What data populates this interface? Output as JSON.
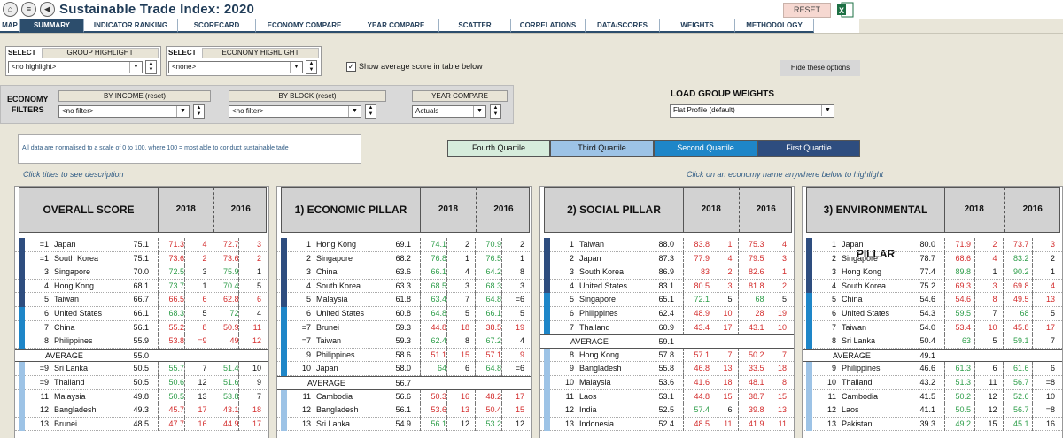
{
  "app": {
    "title": "Sustainable Trade Index: 2020",
    "reset_label": "RESET"
  },
  "tabs": [
    "MAP",
    "SUMMARY",
    "INDICATOR RANKING",
    "SCORECARD",
    "ECONOMY COMPARE",
    "YEAR COMPARE",
    "SCATTER",
    "CORRELATIONS",
    "DATA/SCORES",
    "WEIGHTS",
    "METHODOLOGY"
  ],
  "active_tab": "SUMMARY",
  "select_group": {
    "select_label": "SELECT",
    "title": "GROUP HIGHLIGHT",
    "value": "<no highlight>"
  },
  "select_economy": {
    "select_label": "SELECT",
    "title": "ECONOMY HIGHLIGHT",
    "value": "<none>"
  },
  "show_avg": {
    "label": "Show average score in table below",
    "checked": true
  },
  "hide_options_label": "Hide these options",
  "filters": {
    "label_line1": "ECONOMY",
    "label_line2": "FILTERS",
    "by_income": {
      "title": "BY INCOME (reset)",
      "value": "no filter>"
    },
    "by_block": {
      "title": "BY BLOCK (reset)",
      "value": "no filter>"
    },
    "year_compare": {
      "title": "YEAR COMPARE",
      "value": "Actuals"
    }
  },
  "weights": {
    "title": "LOAD GROUP WEIGHTS",
    "value": "Flat Profile (default)"
  },
  "note": "All data are normalised to a scale of 0 to 100, where 100 = most able to conduct sustainable tade",
  "quartiles": [
    {
      "label": "Fourth Quartile",
      "color": "#d6ecdc"
    },
    {
      "label": "Third Quartile",
      "color": "#9dc3e6"
    },
    {
      "label": "Second Quartile",
      "color": "#1e86c8"
    },
    {
      "label": "First Quartile",
      "color": "#2e4d7f"
    }
  ],
  "hints": {
    "left": "Click titles to see description",
    "right": "Click on an economy name anywhere below to highlight"
  },
  "panels": [
    {
      "title": "OVERALL SCORE",
      "y1": "2018",
      "y2": "2016",
      "rows": [
        {
          "q": 1,
          "rank": "=1",
          "name": "Japan",
          "score": "75.1",
          "v1": "71.3",
          "c1": "r",
          "r1": "4",
          "v2": "72.7",
          "c2": "r",
          "r2": "3"
        },
        {
          "q": 1,
          "rank": "=1",
          "name": "South Korea",
          "score": "75.1",
          "v1": "73.6",
          "c1": "r",
          "r1": "2",
          "v2": "73.6",
          "c2": "r",
          "r2": "2"
        },
        {
          "q": 1,
          "rank": "3",
          "name": "Singapore",
          "score": "70.0",
          "v1": "72.5",
          "c1": "g",
          "r1": "3",
          "v2": "75.9",
          "c2": "g",
          "r2": "1"
        },
        {
          "q": 1,
          "rank": "4",
          "name": "Hong Kong",
          "score": "68.1",
          "v1": "73.7",
          "c1": "g",
          "r1": "1",
          "v2": "70.4",
          "c2": "g",
          "r2": "5"
        },
        {
          "q": 1,
          "rank": "5",
          "name": "Taiwan",
          "score": "66.7",
          "v1": "66.5",
          "c1": "r",
          "r1": "6",
          "v2": "62.8",
          "c2": "r",
          "r2": "6"
        },
        {
          "q": 2,
          "rank": "6",
          "name": "United States",
          "score": "66.1",
          "v1": "68.3",
          "c1": "g",
          "r1": "5",
          "v2": "72",
          "c2": "g",
          "r2": "4"
        },
        {
          "q": 2,
          "rank": "7",
          "name": "China",
          "score": "56.1",
          "v1": "55.2",
          "c1": "r",
          "r1": "8",
          "v2": "50.9",
          "c2": "r",
          "r2": "11"
        },
        {
          "q": 2,
          "rank": "8",
          "name": "Philippines",
          "score": "55.9",
          "v1": "53.8",
          "c1": "r",
          "r1": "=9",
          "v2": "49",
          "c2": "r",
          "r2": "12"
        },
        {
          "avg": true,
          "name": "AVERAGE",
          "score": "55.0"
        },
        {
          "q": 3,
          "rank": "=9",
          "name": "Sri Lanka",
          "score": "50.5",
          "v1": "55.7",
          "c1": "g",
          "r1": "7",
          "v2": "51.4",
          "c2": "g",
          "r2": "10"
        },
        {
          "q": 3,
          "rank": "=9",
          "name": "Thailand",
          "score": "50.5",
          "v1": "50.6",
          "c1": "g",
          "r1": "12",
          "v2": "51.6",
          "c2": "g",
          "r2": "9"
        },
        {
          "q": 3,
          "rank": "11",
          "name": "Malaysia",
          "score": "49.8",
          "v1": "50.5",
          "c1": "g",
          "r1": "13",
          "v2": "53.8",
          "c2": "g",
          "r2": "7"
        },
        {
          "q": 3,
          "rank": "12",
          "name": "Bangladesh",
          "score": "49.3",
          "v1": "45.7",
          "c1": "r",
          "r1": "17",
          "v2": "43.1",
          "c2": "r",
          "r2": "18"
        },
        {
          "q": 3,
          "rank": "13",
          "name": "Brunei",
          "score": "48.5",
          "v1": "47.7",
          "c1": "r",
          "r1": "16",
          "v2": "44.9",
          "c2": "r",
          "r2": "17"
        }
      ]
    },
    {
      "title": "1) ECONOMIC PILLAR",
      "y1": "2018",
      "y2": "2016",
      "rows": [
        {
          "q": 1,
          "rank": "1",
          "name": "Hong Kong",
          "score": "69.1",
          "v1": "74.1",
          "c1": "g",
          "r1": "2",
          "v2": "70.9",
          "c2": "g",
          "r2": "2"
        },
        {
          "q": 1,
          "rank": "2",
          "name": "Singapore",
          "score": "68.2",
          "v1": "76.8",
          "c1": "g",
          "r1": "1",
          "v2": "76.5",
          "c2": "g",
          "r2": "1"
        },
        {
          "q": 1,
          "rank": "3",
          "name": "China",
          "score": "63.6",
          "v1": "66.1",
          "c1": "g",
          "r1": "4",
          "v2": "64.2",
          "c2": "g",
          "r2": "8"
        },
        {
          "q": 1,
          "rank": "4",
          "name": "South Korea",
          "score": "63.3",
          "v1": "68.5",
          "c1": "g",
          "r1": "3",
          "v2": "68.3",
          "c2": "g",
          "r2": "3"
        },
        {
          "q": 1,
          "rank": "5",
          "name": "Malaysia",
          "score": "61.8",
          "v1": "63.4",
          "c1": "g",
          "r1": "7",
          "v2": "64.8",
          "c2": "g",
          "r2": "=6"
        },
        {
          "q": 2,
          "rank": "6",
          "name": "United States",
          "score": "60.8",
          "v1": "64.8",
          "c1": "g",
          "r1": "5",
          "v2": "66.1",
          "c2": "g",
          "r2": "5"
        },
        {
          "q": 2,
          "rank": "=7",
          "name": "Brunei",
          "score": "59.3",
          "v1": "44.8",
          "c1": "r",
          "r1": "18",
          "v2": "38.5",
          "c2": "r",
          "r2": "19"
        },
        {
          "q": 2,
          "rank": "=7",
          "name": "Taiwan",
          "score": "59.3",
          "v1": "62.4",
          "c1": "g",
          "r1": "8",
          "v2": "67.2",
          "c2": "g",
          "r2": "4"
        },
        {
          "q": 2,
          "rank": "9",
          "name": "Philippines",
          "score": "58.6",
          "v1": "51.1",
          "c1": "r",
          "r1": "15",
          "v2": "57.1",
          "c2": "r",
          "r2": "9"
        },
        {
          "q": 2,
          "rank": "10",
          "name": "Japan",
          "score": "58.0",
          "v1": "64",
          "c1": "g",
          "r1": "6",
          "v2": "64.8",
          "c2": "g",
          "r2": "=6"
        },
        {
          "avg": true,
          "name": "AVERAGE",
          "score": "56.7"
        },
        {
          "q": 3,
          "rank": "11",
          "name": "Cambodia",
          "score": "56.6",
          "v1": "50.3",
          "c1": "r",
          "r1": "16",
          "v2": "48.2",
          "c2": "r",
          "r2": "17"
        },
        {
          "q": 3,
          "rank": "12",
          "name": "Bangladesh",
          "score": "56.1",
          "v1": "53.6",
          "c1": "r",
          "r1": "13",
          "v2": "50.4",
          "c2": "r",
          "r2": "15"
        },
        {
          "q": 3,
          "rank": "13",
          "name": "Sri Lanka",
          "score": "54.9",
          "v1": "56.1",
          "c1": "g",
          "r1": "12",
          "v2": "53.2",
          "c2": "g",
          "r2": "12"
        }
      ]
    },
    {
      "title": "2) SOCIAL PILLAR",
      "y1": "2018",
      "y2": "2016",
      "rows": [
        {
          "q": 1,
          "rank": "1",
          "name": "Taiwan",
          "score": "88.0",
          "v1": "83.8",
          "c1": "r",
          "r1": "1",
          "v2": "75.3",
          "c2": "r",
          "r2": "4"
        },
        {
          "q": 1,
          "rank": "2",
          "name": "Japan",
          "score": "87.3",
          "v1": "77.9",
          "c1": "r",
          "r1": "4",
          "v2": "79.5",
          "c2": "r",
          "r2": "3"
        },
        {
          "q": 1,
          "rank": "3",
          "name": "South Korea",
          "score": "86.9",
          "v1": "83",
          "c1": "r",
          "r1": "2",
          "v2": "82.6",
          "c2": "r",
          "r2": "1"
        },
        {
          "q": 1,
          "rank": "4",
          "name": "United States",
          "score": "83.1",
          "v1": "80.5",
          "c1": "r",
          "r1": "3",
          "v2": "81.8",
          "c2": "r",
          "r2": "2"
        },
        {
          "q": 2,
          "rank": "5",
          "name": "Singapore",
          "score": "65.1",
          "v1": "72.1",
          "c1": "g",
          "r1": "5",
          "v2": "68",
          "c2": "g",
          "r2": "5"
        },
        {
          "q": 2,
          "rank": "6",
          "name": "Philippines",
          "score": "62.4",
          "v1": "48.9",
          "c1": "r",
          "r1": "10",
          "v2": "28",
          "c2": "r",
          "r2": "19"
        },
        {
          "q": 2,
          "rank": "7",
          "name": "Thailand",
          "score": "60.9",
          "v1": "43.4",
          "c1": "r",
          "r1": "17",
          "v2": "43.1",
          "c2": "r",
          "r2": "10"
        },
        {
          "avg": true,
          "name": "AVERAGE",
          "score": "59.1"
        },
        {
          "q": 3,
          "rank": "8",
          "name": "Hong Kong",
          "score": "57.8",
          "v1": "57.1",
          "c1": "r",
          "r1": "7",
          "v2": "50.2",
          "c2": "r",
          "r2": "7"
        },
        {
          "q": 3,
          "rank": "9",
          "name": "Bangladesh",
          "score": "55.8",
          "v1": "46.8",
          "c1": "r",
          "r1": "13",
          "v2": "33.5",
          "c2": "r",
          "r2": "18"
        },
        {
          "q": 3,
          "rank": "10",
          "name": "Malaysia",
          "score": "53.6",
          "v1": "41.6",
          "c1": "r",
          "r1": "18",
          "v2": "48.1",
          "c2": "r",
          "r2": "8"
        },
        {
          "q": 3,
          "rank": "11",
          "name": "Laos",
          "score": "53.1",
          "v1": "44.8",
          "c1": "r",
          "r1": "15",
          "v2": "38.7",
          "c2": "r",
          "r2": "15"
        },
        {
          "q": 3,
          "rank": "12",
          "name": "India",
          "score": "52.5",
          "v1": "57.4",
          "c1": "g",
          "r1": "6",
          "v2": "39.8",
          "c2": "r",
          "r2": "13"
        },
        {
          "q": 3,
          "rank": "13",
          "name": "Indonesia",
          "score": "52.4",
          "v1": "48.5",
          "c1": "r",
          "r1": "11",
          "v2": "41.9",
          "c2": "r",
          "r2": "11"
        }
      ]
    },
    {
      "title": "3) ENVIRONMENTAL PILLAR",
      "y1": "2018",
      "y2": "2016",
      "rows": [
        {
          "q": 1,
          "rank": "1",
          "name": "Japan",
          "score": "80.0",
          "v1": "71.9",
          "c1": "r",
          "r1": "2",
          "v2": "73.7",
          "c2": "r",
          "r2": "3"
        },
        {
          "q": 1,
          "rank": "2",
          "name": "Singapore",
          "score": "78.7",
          "v1": "68.6",
          "c1": "r",
          "r1": "4",
          "v2": "83.2",
          "c2": "g",
          "r2": "2"
        },
        {
          "q": 1,
          "rank": "3",
          "name": "Hong Kong",
          "score": "77.4",
          "v1": "89.8",
          "c1": "g",
          "r1": "1",
          "v2": "90.2",
          "c2": "g",
          "r2": "1"
        },
        {
          "q": 1,
          "rank": "4",
          "name": "South Korea",
          "score": "75.2",
          "v1": "69.3",
          "c1": "r",
          "r1": "3",
          "v2": "69.8",
          "c2": "r",
          "r2": "4"
        },
        {
          "q": 2,
          "rank": "5",
          "name": "China",
          "score": "54.6",
          "v1": "54.6",
          "c1": "r",
          "r1": "8",
          "v2": "49.5",
          "c2": "r",
          "r2": "13"
        },
        {
          "q": 2,
          "rank": "6",
          "name": "United States",
          "score": "54.3",
          "v1": "59.5",
          "c1": "g",
          "r1": "7",
          "v2": "68",
          "c2": "g",
          "r2": "5"
        },
        {
          "q": 2,
          "rank": "7",
          "name": "Taiwan",
          "score": "54.0",
          "v1": "53.4",
          "c1": "r",
          "r1": "10",
          "v2": "45.8",
          "c2": "r",
          "r2": "17"
        },
        {
          "q": 2,
          "rank": "8",
          "name": "Sri Lanka",
          "score": "50.4",
          "v1": "63",
          "c1": "g",
          "r1": "5",
          "v2": "59.1",
          "c2": "g",
          "r2": "7"
        },
        {
          "avg": true,
          "name": "AVERAGE",
          "score": "49.1"
        },
        {
          "q": 3,
          "rank": "9",
          "name": "Philippines",
          "score": "46.6",
          "v1": "61.3",
          "c1": "g",
          "r1": "6",
          "v2": "61.6",
          "c2": "g",
          "r2": "6"
        },
        {
          "q": 3,
          "rank": "10",
          "name": "Thailand",
          "score": "43.2",
          "v1": "51.3",
          "c1": "g",
          "r1": "11",
          "v2": "56.7",
          "c2": "g",
          "r2": "=8"
        },
        {
          "q": 3,
          "rank": "11",
          "name": "Cambodia",
          "score": "41.5",
          "v1": "50.2",
          "c1": "g",
          "r1": "12",
          "v2": "52.6",
          "c2": "g",
          "r2": "10"
        },
        {
          "q": 3,
          "rank": "12",
          "name": "Laos",
          "score": "41.1",
          "v1": "50.5",
          "c1": "g",
          "r1": "12",
          "v2": "56.7",
          "c2": "g",
          "r2": "=8"
        },
        {
          "q": 3,
          "rank": "13",
          "name": "Pakistan",
          "score": "39.3",
          "v1": "49.2",
          "c1": "g",
          "r1": "15",
          "v2": "45.1",
          "c2": "g",
          "r2": "16"
        }
      ]
    }
  ]
}
